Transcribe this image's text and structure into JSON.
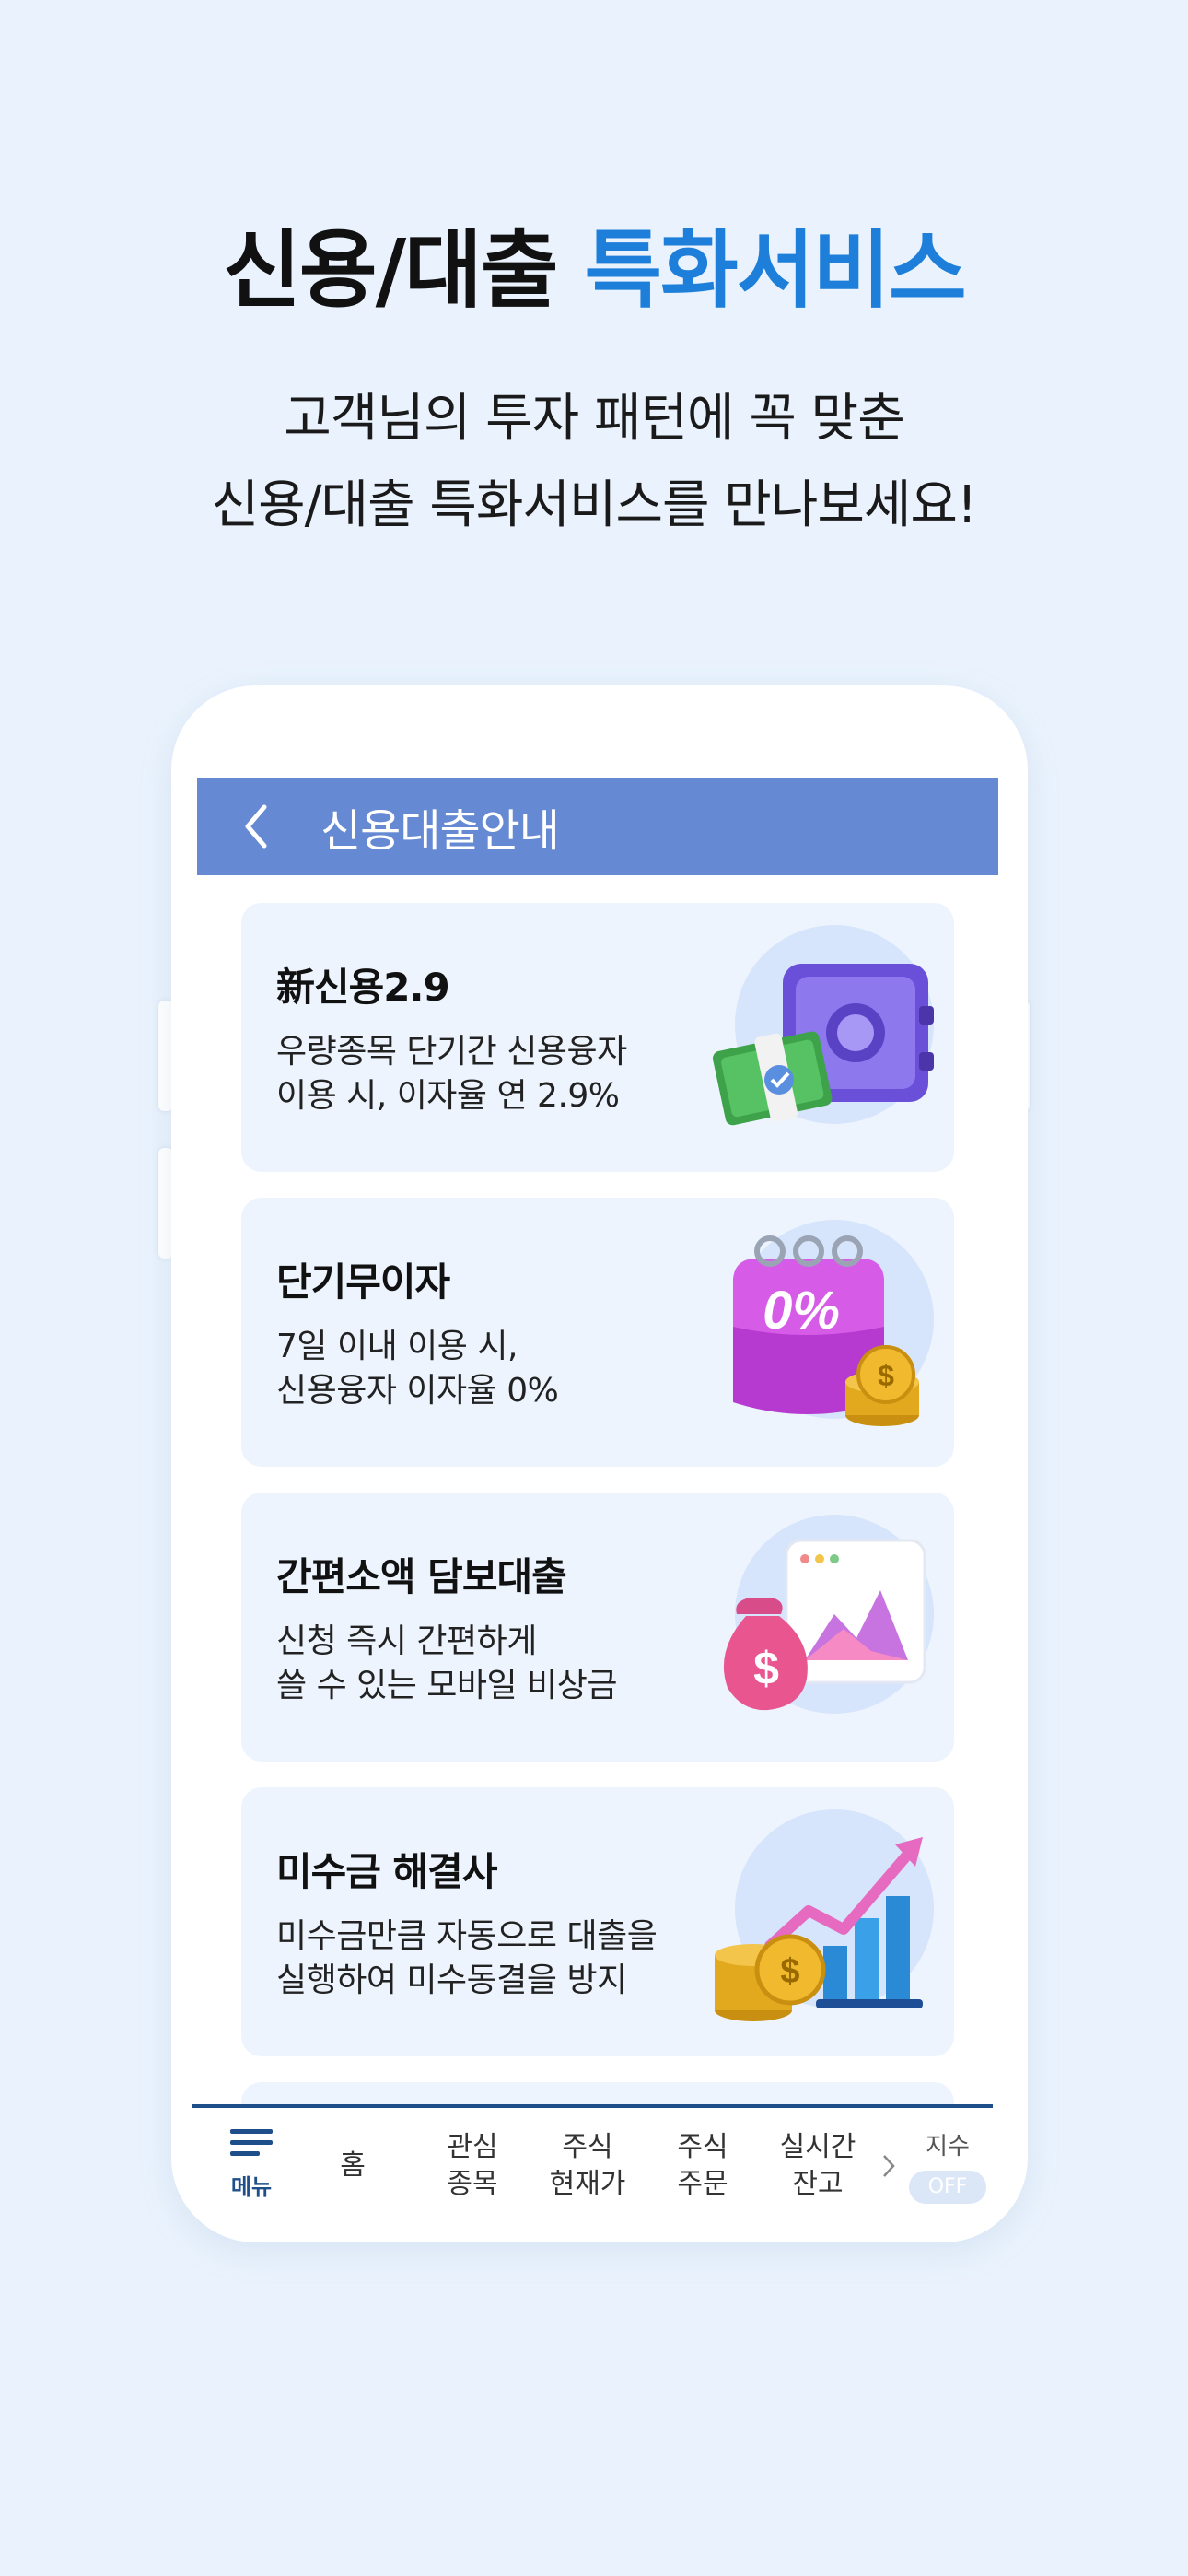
{
  "headline": {
    "part1": "신용/대출",
    "part2": "특화서비스"
  },
  "subtitle": {
    "line1": "고객님의 투자 패턴에 꼭 맞춘",
    "line2": "신용/대출 특화서비스를 만나보세요!"
  },
  "appbar": {
    "title": "신용대출안내",
    "back_icon": "chevron-left-icon"
  },
  "cards": [
    {
      "title": "新신용2.9",
      "line1": "우량종목 단기간 신용융자",
      "line2": "이용 시, 이자율 연 2.9%",
      "icon": "safe-money-icon"
    },
    {
      "title": "단기무이자",
      "line1": "7일 이내 이용 시,",
      "line2": "신용융자 이자율 0%",
      "icon": "calendar-zero-percent-icon",
      "badge": "0%"
    },
    {
      "title": "간편소액 담보대출",
      "line1": "신청 즉시 간편하게",
      "line2": "쓸 수 있는 모바일 비상금",
      "icon": "money-bag-chart-icon"
    },
    {
      "title": "미수금 해결사",
      "line1": "미수금만큼 자동으로 대출을",
      "line2": "실행하여 미수동결을 방지",
      "icon": "coins-growth-chart-icon"
    }
  ],
  "nav": {
    "menu": "메뉴",
    "home": "홈",
    "watch": {
      "l1": "관심",
      "l2": "종목"
    },
    "price": {
      "l1": "주식",
      "l2": "현재가"
    },
    "order": {
      "l1": "주식",
      "l2": "주문"
    },
    "balance": {
      "l1": "실시간",
      "l2": "잔고"
    },
    "index": {
      "label": "지수",
      "toggle": "OFF"
    }
  },
  "colors": {
    "accent": "#1d7fd9",
    "appbar": "#6689d3",
    "card_bg": "#edf4fe",
    "page_bg": "#eaf3fd",
    "nav_border": "#1f4f8a"
  }
}
